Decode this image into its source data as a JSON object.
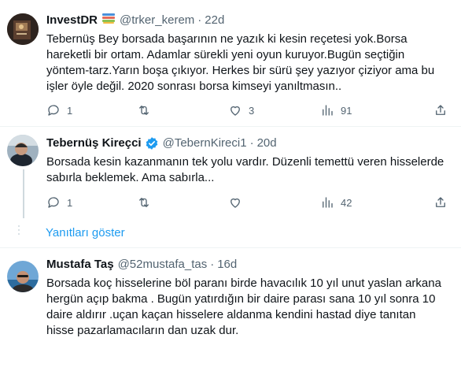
{
  "tweets": [
    {
      "name": "InvestDR",
      "handle": "@trker_kerem",
      "separator": "·",
      "time": "22d",
      "text_lines": [
        "Tebernüş Bey borsada başarının ne yazık ki kesin reçetesi yok.Borsa",
        "hareketli bir ortam. Adamlar sürekli yeni oyun kuruyor.Bugün seçtiğin",
        "yöntem-tarz.Yarın boşa çıkıyor. Herkes bir sürü şey yazıyor çiziyor ama bu",
        "işler öyle değil. 2020 sonrası borsa kimseyi yanıltmasın.."
      ],
      "replies": "1",
      "retweets": "",
      "likes": "3",
      "views": "91",
      "badge_icon": "books-icon"
    },
    {
      "name": "Tebernüş Kireçci",
      "handle": "@TebernKireci1",
      "separator": "·",
      "time": "20d",
      "verified": true,
      "text_lines": [
        "Borsada kesin kazanmanın tek yolu vardır. Düzenli temettü veren hisselerde",
        "sabırla beklemek. Ama sabırla..."
      ],
      "replies": "1",
      "retweets": "",
      "likes": "",
      "views": "42"
    },
    {
      "name": "Mustafa Taş",
      "handle": "@52mustafa_tas",
      "separator": "·",
      "time": "16d",
      "text_lines": [
        "Borsada koç hisselerine böl paranı birde havacılık 10 yıl unut yaslan arkana",
        "hergün açıp bakma . Bugün yatırdığın bir daire parası sana 10 yıl sonra 10",
        "daire aldırır .uçan kaçan hisselere aldanma kendini hastad diye tanıtan",
        "hisse pazarlamacıların dan uzak dur."
      ]
    }
  ],
  "show_replies_label": "Yanıtları göster",
  "colors": {
    "text": "#0f1419",
    "secondary": "#536471",
    "link": "#1d9bf0",
    "verified": "#1d9bf0",
    "divider": "#eff3f4"
  }
}
